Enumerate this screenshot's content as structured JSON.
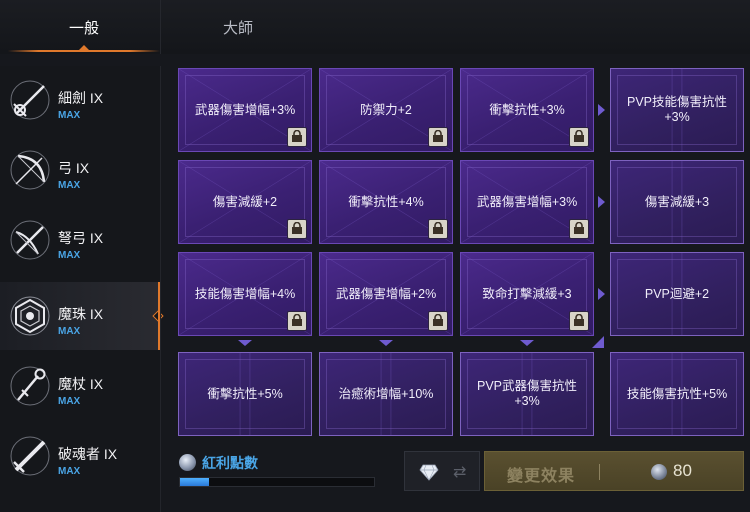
{
  "tabs": [
    {
      "label": "一般",
      "active": true
    },
    {
      "label": "大師",
      "active": false
    }
  ],
  "weapons": [
    {
      "name": "細劍 IX",
      "level": "MAX",
      "icon": "rapier-icon"
    },
    {
      "name": "弓 IX",
      "level": "MAX",
      "icon": "bow-icon"
    },
    {
      "name": "弩弓 IX",
      "level": "MAX",
      "icon": "crossbow-icon"
    },
    {
      "name": "魔珠 IX",
      "level": "MAX",
      "icon": "orb-icon",
      "active": true
    },
    {
      "name": "魔杖 IX",
      "level": "MAX",
      "icon": "wand-icon"
    },
    {
      "name": "破魂者 IX",
      "level": "MAX",
      "icon": "soulbreaker-icon"
    }
  ],
  "grid": [
    [
      {
        "label": "武器傷害增幅+3%",
        "locked": true
      },
      {
        "label": "防禦力+2",
        "locked": true
      },
      {
        "label": "衝擊抗性+3%",
        "locked": true
      },
      {
        "label": "PVP技能傷害抗性+3%",
        "locked": false
      }
    ],
    [
      {
        "label": "傷害減緩+2",
        "locked": true
      },
      {
        "label": "衝擊抗性+4%",
        "locked": true
      },
      {
        "label": "武器傷害增幅+3%",
        "locked": true
      },
      {
        "label": "傷害減緩+3",
        "locked": false
      }
    ],
    [
      {
        "label": "技能傷害增幅+4%",
        "locked": true
      },
      {
        "label": "武器傷害增幅+2%",
        "locked": true
      },
      {
        "label": "致命打擊減緩+3",
        "locked": true
      },
      {
        "label": "PVP迴避+2",
        "locked": false
      }
    ],
    [
      {
        "label": "衝擊抗性+5%",
        "locked": false
      },
      {
        "label": "治癒術增幅+10%",
        "locked": false
      },
      {
        "label": "PVP武器傷害抗性+3%",
        "locked": false
      },
      {
        "label": "技能傷害抗性+5%",
        "locked": false
      }
    ]
  ],
  "bonus": {
    "label": "紅利點數",
    "progress": 0.15
  },
  "change_button": {
    "label": "變更效果",
    "cost": "80"
  },
  "colors": {
    "accent": "#e0792c",
    "max": "#4aa5e6",
    "cell": "#3a2072"
  }
}
